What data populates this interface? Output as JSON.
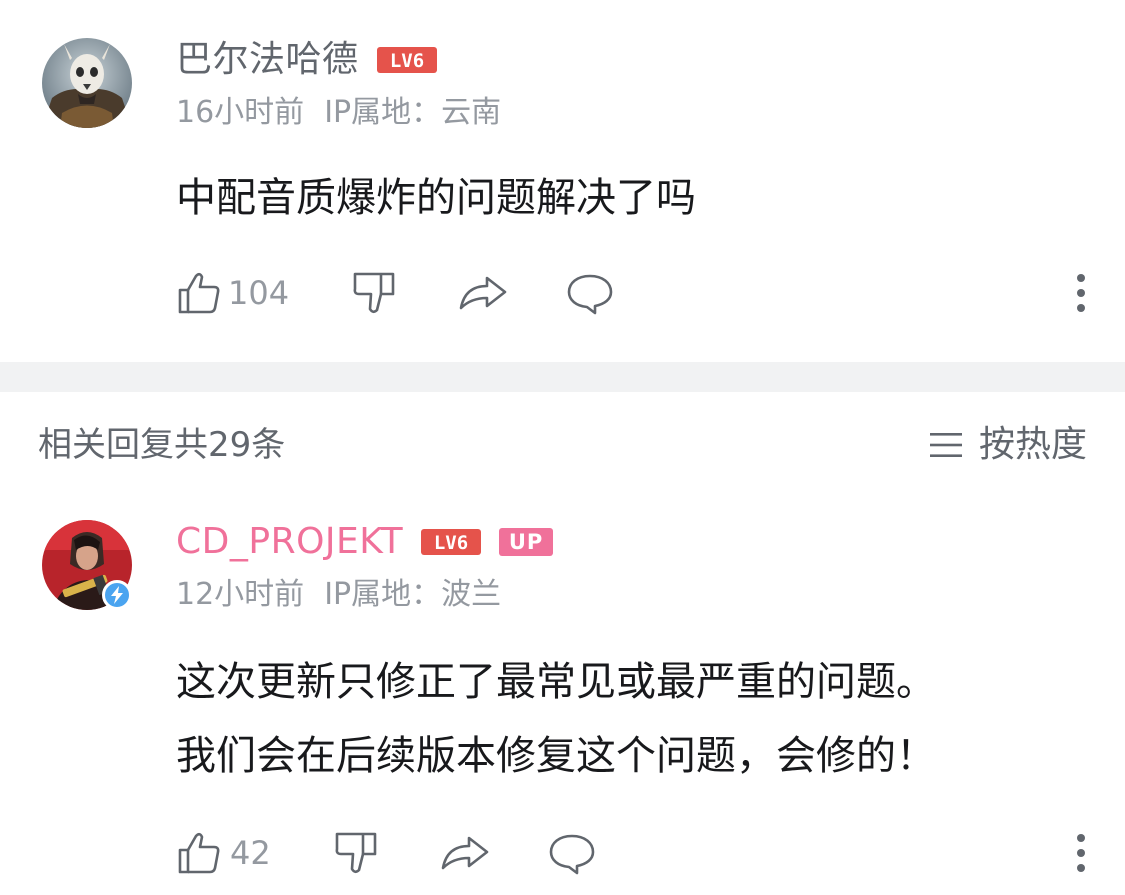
{
  "comment_main": {
    "username": "巴尔法哈德",
    "level": "LV6",
    "time": "16小时前",
    "ip_label": "IP属地：",
    "ip_location": "云南",
    "text": "中配音质爆炸的问题解决了吗",
    "likes": "104",
    "avatar_icon": "skull-warrior-avatar"
  },
  "replies_header": {
    "count_text": "相关回复共29条",
    "sort_label": "按热度",
    "sort_icon": "menu-lines-icon"
  },
  "reply": {
    "username": "CD_PROJEKT",
    "level": "LV6",
    "up_badge": "UP",
    "time": "12小时前",
    "ip_label": "IP属地：",
    "ip_location": "波兰",
    "text_line1": "这次更新只修正了最常见或最严重的问题。",
    "text_line2": "我们会在后续版本修复这个问题，会修的！",
    "likes": "42",
    "avatar_icon": "cyberpunk-character-avatar",
    "verified_icon": "lightning-verified-icon"
  },
  "colors": {
    "username_gray": "#61666d",
    "username_pink": "#f0719a",
    "meta_gray": "#9499a0",
    "level_red": "#e5534b",
    "up_pink": "#f0719a",
    "divider": "#f1f2f3",
    "verify_blue": "#4aa4f0"
  }
}
